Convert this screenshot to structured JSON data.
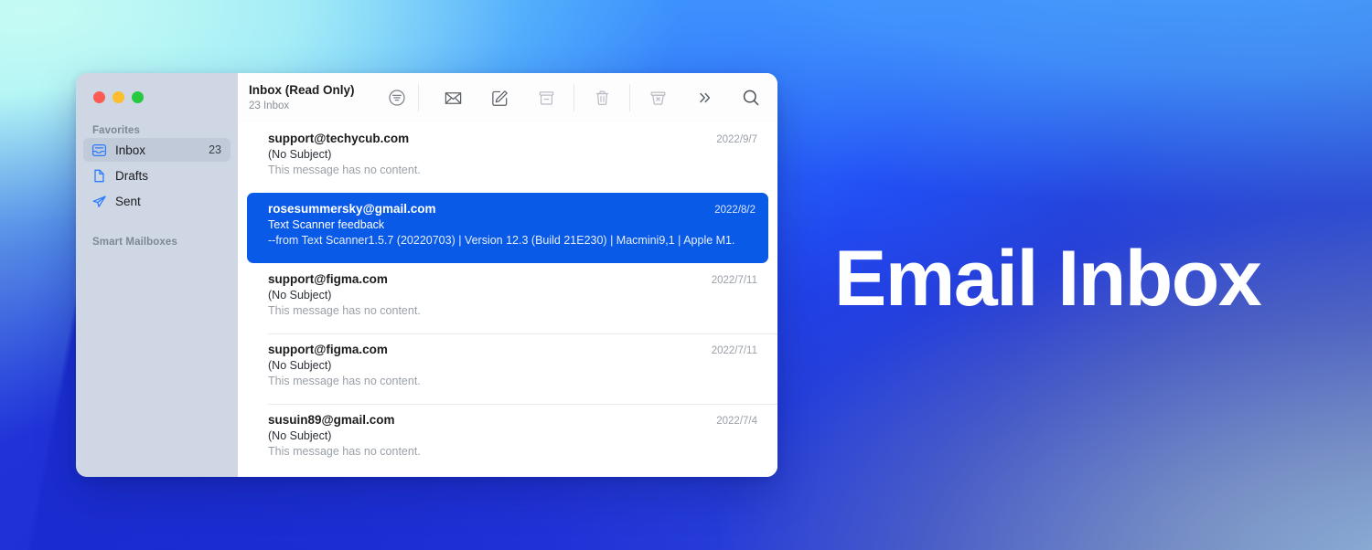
{
  "headline": "Email Inbox",
  "window": {
    "traffic_lights": [
      {
        "name": "close",
        "color": "#fc5b54"
      },
      {
        "name": "minimize",
        "color": "#fdbd2e"
      },
      {
        "name": "zoom",
        "color": "#27c93f"
      }
    ]
  },
  "sidebar": {
    "favorites_label": "Favorites",
    "smart_mailboxes_label": "Smart Mailboxes",
    "items": [
      {
        "label": "Inbox",
        "count": "23",
        "icon": "inbox-icon",
        "active": true
      },
      {
        "label": "Drafts",
        "count": "",
        "icon": "document-icon",
        "active": false
      },
      {
        "label": "Sent",
        "count": "",
        "icon": "paper-plane-icon",
        "active": false
      }
    ]
  },
  "toolbar": {
    "mailbox_title": "Inbox (Read Only)",
    "mailbox_subtitle": "23 Inbox",
    "filter_label": "filter-icon",
    "buttons": [
      {
        "name": "mark-unread-button",
        "icon": "envelope-icon",
        "dim": false
      },
      {
        "name": "compose-button",
        "icon": "compose-icon",
        "dim": false
      },
      {
        "name": "archive-button",
        "icon": "archive-icon",
        "dim": true
      },
      {
        "name": "delete-button",
        "icon": "trash-icon",
        "dim": true
      },
      {
        "name": "junk-button",
        "icon": "junk-icon",
        "dim": true
      },
      {
        "name": "more-button",
        "icon": "chevron-double-right-icon",
        "dim": false
      },
      {
        "name": "search-button",
        "icon": "search-icon",
        "dim": false
      }
    ]
  },
  "messages": [
    {
      "from": "support@techycub.com",
      "subject": "(No Subject)",
      "preview": "This message has no content.",
      "date": "2022/9/7",
      "selected": false
    },
    {
      "from": "rosesummersky@gmail.com",
      "subject": "Text Scanner feedback",
      "preview": "--from Text Scanner1.5.7 (20220703) | Version 12.3 (Build 21E230) | Macmini9,1 | Apple M1.",
      "date": "2022/8/2",
      "selected": true
    },
    {
      "from": "support@figma.com",
      "subject": "(No Subject)",
      "preview": "This message has no content.",
      "date": "2022/7/11",
      "selected": false
    },
    {
      "from": "support@figma.com",
      "subject": "(No Subject)",
      "preview": "This message has no content.",
      "date": "2022/7/11",
      "selected": false
    },
    {
      "from": "susuin89@gmail.com",
      "subject": "(No Subject)",
      "preview": "This message has no content.",
      "date": "2022/7/4",
      "selected": false
    }
  ],
  "colors": {
    "selection_blue": "#0a5ae8",
    "sidebar_bg": "#ced7e3",
    "sidebar_active": "#c0cad9",
    "accent_icon_blue": "#2b7cff",
    "headline_color": "#ffffff"
  }
}
